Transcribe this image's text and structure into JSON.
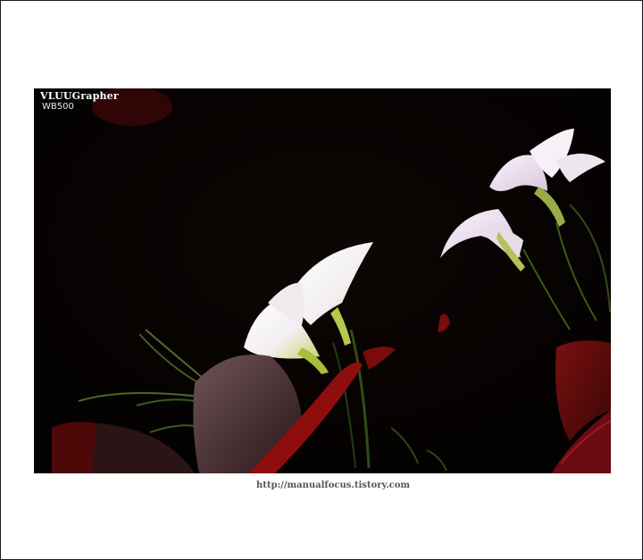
{
  "photo": {
    "watermark_brand": "VLUUGrapher",
    "watermark_model": "WB500",
    "subject": "photo-of-white-oxalis-flowers"
  },
  "caption": {
    "url_text": "http://manualfocus.tistory.com"
  },
  "colors": {
    "frame_border": "#1a1a1a",
    "photo_background": "#050202",
    "caption_text": "#555555"
  }
}
